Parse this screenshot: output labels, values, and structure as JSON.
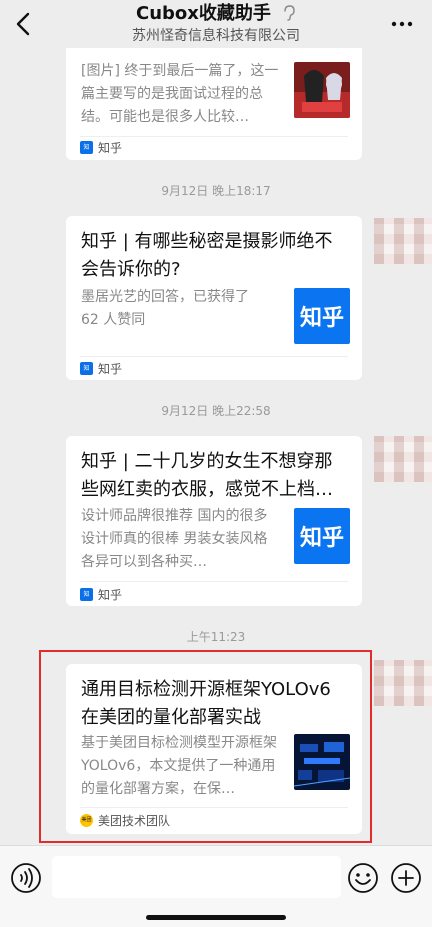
{
  "header": {
    "title": "Cubox收藏助手",
    "subtitle": "苏州怪奇信息科技有限公司"
  },
  "messages": [
    {
      "desc": "[图片] 终于到最后一篇了，这一篇主要写的是我面试过程的总结。可能也是很多人比较…",
      "source": "知乎",
      "thumb": "anime-figure-image"
    },
    {
      "time": "9月12日 晚上18:17",
      "title": "知乎 | 有哪些秘密是摄影师绝不会告诉你的?",
      "desc": "墨居光艺的回答，已获得了 62 人赞同",
      "source": "知乎",
      "thumb_text": "知乎"
    },
    {
      "time": "9月12日 晚上22:58",
      "title": "知乎 | 二十几岁的女生不想穿那些网红卖的衣服，感觉不上档…",
      "desc": "设计师品牌很推荐 国内的很多设计师真的很棒 男装女装风格各异可以到各种买…",
      "source": "知乎",
      "thumb_text": "知乎"
    },
    {
      "time": "上午11:23",
      "title": "通用目标检测开源框架YOLOv6在美团的量化部署实战",
      "desc": "基于美团目标检测模型开源框架 YOLOv6，本文提供了一种通用的量化部署方案，在保…",
      "source": "美团技术团队",
      "source_logo": "美团",
      "thumb": "blue-tech-image"
    }
  ],
  "bottom": {
    "input_placeholder": ""
  },
  "colors": {
    "background": "#ededed",
    "zhihu_blue": "#0b74f0",
    "highlight_red": "#e22c2c"
  }
}
